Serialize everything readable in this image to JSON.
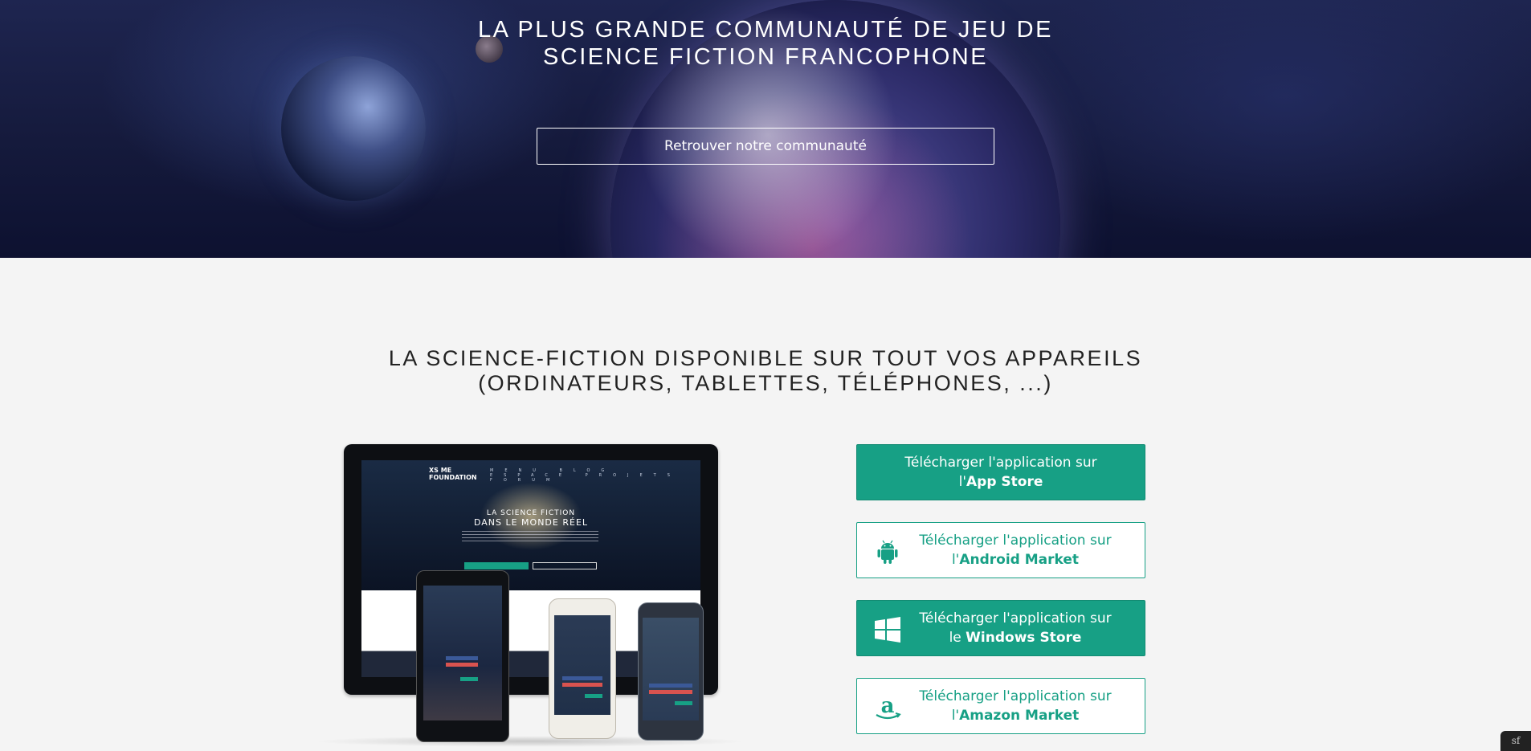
{
  "hero": {
    "title": "LA PLUS GRANDE COMMUNAUTÉ DE JEU DE\nSCIENCE FICTION FRANCOPHONE",
    "cta_label": "Retrouver notre communauté"
  },
  "section": {
    "title_line1": "LA SCIENCE-FICTION DISPONIBLE SUR TOUT VOS APPAREILS",
    "title_line2": "(ORDINATEURS, TABLETTES, TÉLÉPHONES, ...)"
  },
  "mockup": {
    "logo_line1": "XS ME",
    "logo_line2": "FOUNDATION",
    "nav": "MENU BLOG ESPACE PROJETS FORUM",
    "headline_small": "LA SCIENCE FICTION",
    "headline_big": "DANS LE MONDE RÉEL"
  },
  "stores": [
    {
      "prefix": "Télécharger l'application sur",
      "article": "l'",
      "name": "App Store",
      "style": "filled",
      "icon": ""
    },
    {
      "prefix": "Télécharger l'application sur",
      "article": "l'",
      "name": "Android Market",
      "style": "outline",
      "icon": "android-icon"
    },
    {
      "prefix": "Télécharger l'application sur",
      "article": "le ",
      "name": "Windows Store",
      "style": "filled",
      "icon": "windows-icon"
    },
    {
      "prefix": "Télécharger l'application sur",
      "article": "l'",
      "name": "Amazon Market",
      "style": "outline",
      "icon": "amazon-icon"
    }
  ],
  "colors": {
    "accent": "#17a085",
    "background": "#f4f4f4",
    "hero_dark": "#151a3c"
  },
  "debug_badge": "sf"
}
